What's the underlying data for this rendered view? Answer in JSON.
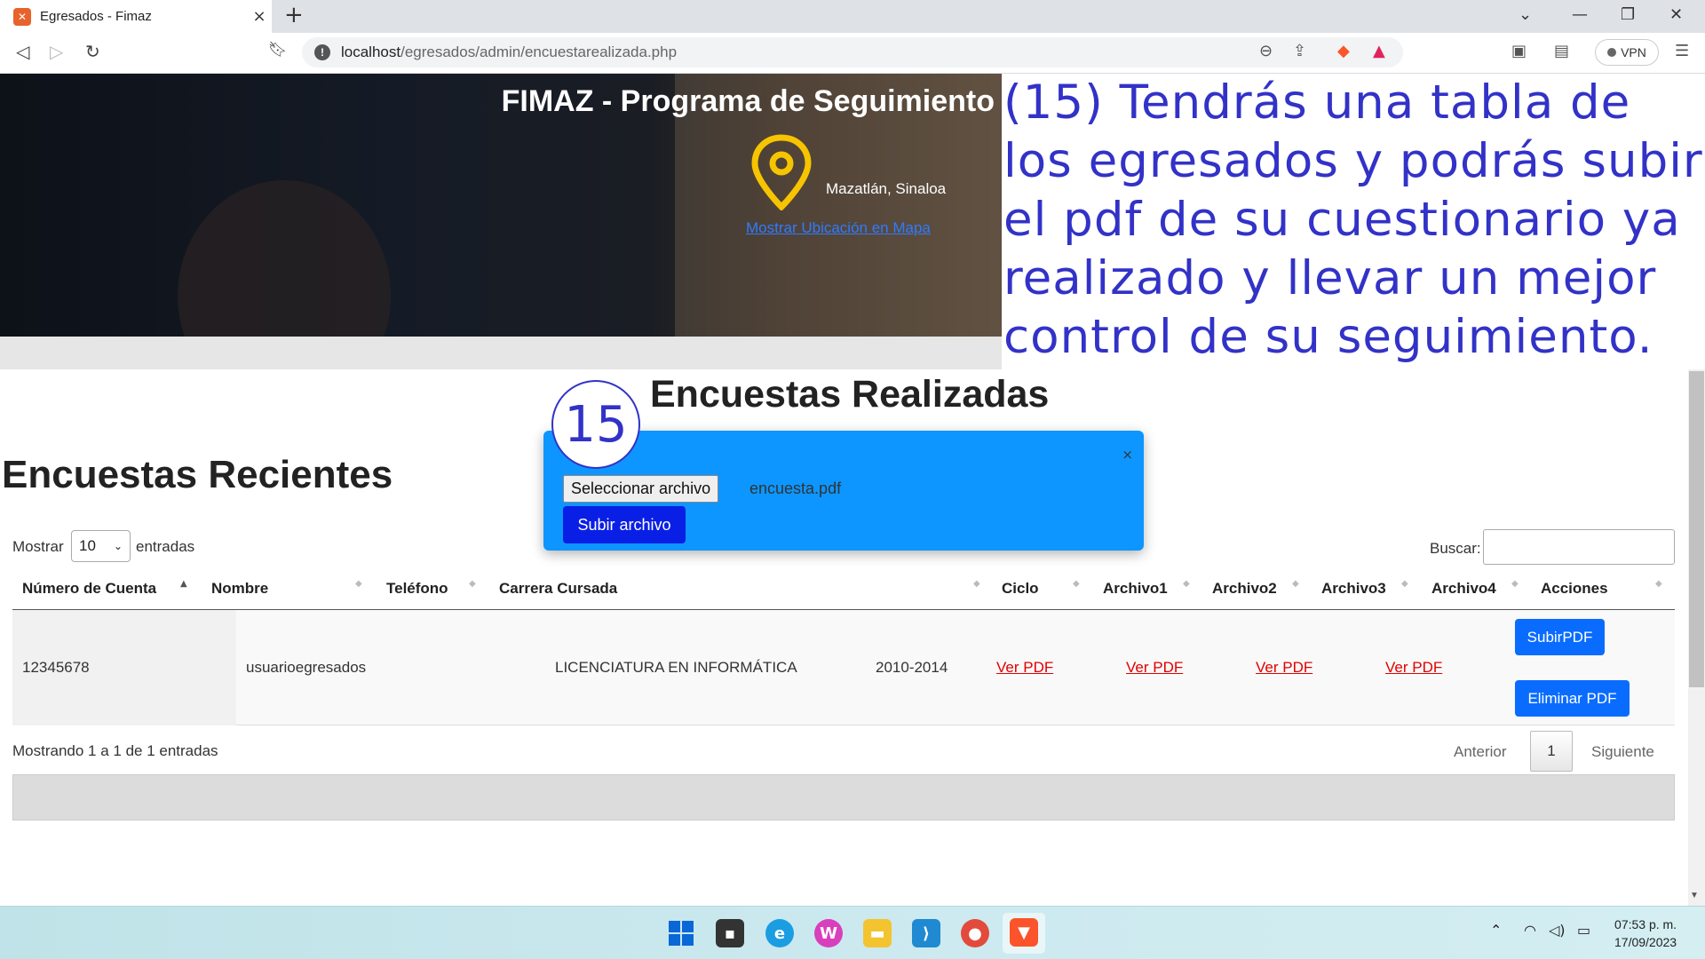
{
  "browser": {
    "tab_title": "Egresados - Fimaz",
    "url_host": "localhost",
    "url_path": "/egresados/admin/encuestarealizada.php",
    "vpn_label": "VPN"
  },
  "hero": {
    "title": "FIMAZ - Programa de Seguimiento",
    "location": "Mazatlán, Sinaloa",
    "map_link": "Mostrar Ubicación en Mapa"
  },
  "annotation": {
    "text": "(15) Tendrás una tabla de los egresados y podrás subir el pdf de su cuestionario ya realizado y llevar un mejor control de su seguimiento.",
    "badge": "15"
  },
  "page": {
    "title": "Encuestas Realizadas",
    "section_title": "Encuestas Recientes"
  },
  "modal": {
    "close": "×",
    "file_button": "Seleccionar archivo",
    "file_name": "encuesta.pdf",
    "upload_button": "Subir archivo"
  },
  "table_controls": {
    "show_label": "Mostrar",
    "show_value": "10",
    "entries_label": "entradas",
    "search_label": "Buscar:"
  },
  "table": {
    "headers": [
      "Número de Cuenta",
      "Nombre",
      "Teléfono",
      "Carrera Cursada",
      "Ciclo",
      "Archivo1",
      "Archivo2",
      "Archivo3",
      "Archivo4",
      "Acciones"
    ],
    "rows": [
      {
        "cuenta": "12345678",
        "nombre": "usuarioegresados",
        "telefono": "",
        "carrera": "LICENCIATURA EN INFORMÁTICA",
        "ciclo": "2010-2014",
        "archivo1": "Ver PDF",
        "archivo2": "Ver PDF",
        "archivo3": "Ver PDF",
        "archivo4": "Ver PDF",
        "action_upload": "SubirPDF",
        "action_delete": "Eliminar PDF"
      }
    ]
  },
  "pagination": {
    "info": "Mostrando 1 a 1 de 1 entradas",
    "previous": "Anterior",
    "page": "1",
    "next": "Siguiente"
  },
  "taskbar": {
    "time": "07:53 p. m.",
    "date": "17/09/2023"
  },
  "colors": {
    "modal_bg": "#0d96ff",
    "upload_button": "#0a1fe6",
    "action_button": "#0a6cff",
    "pdf_link": "#e10000",
    "annotation_text": "#3232c8"
  }
}
